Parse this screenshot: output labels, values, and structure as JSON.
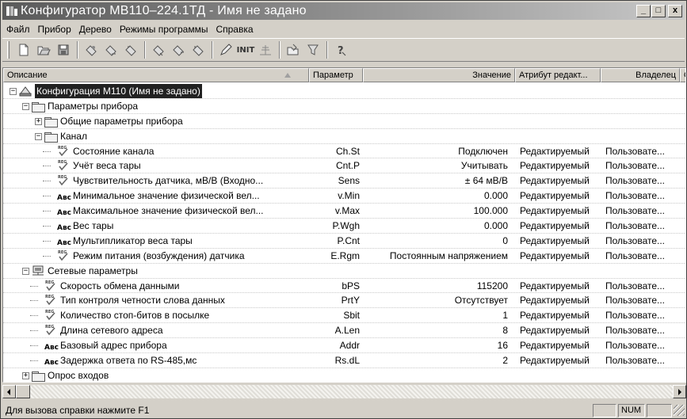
{
  "window": {
    "title": "Конфигуратор МВ110–224.1ТД - Имя не задано",
    "minimize": "_",
    "maximize": "□",
    "close": "x"
  },
  "menu": [
    {
      "label": "Файл"
    },
    {
      "label": "Прибор"
    },
    {
      "label": "Дерево"
    },
    {
      "label": "Режимы программы"
    },
    {
      "label": "Справка"
    }
  ],
  "toolbar": {
    "icons": [
      "new-file-icon",
      "open-file-icon",
      "save-file-icon",
      "device-read-icon",
      "device-write-icon",
      "device-connect-icon",
      "device-read-all-icon",
      "device-write-all-icon",
      "device-check-icon",
      "edit-icon",
      "init-icon",
      "network-icon",
      "folder-open-icon",
      "filter-icon",
      "help-icon"
    ],
    "init_label": "INIT"
  },
  "columns": {
    "desc": "Описание",
    "param": "Параметр",
    "value": "Значение",
    "attr": "Атрибут редакт...",
    "owner": "Владелец",
    "extra": "О"
  },
  "rows": [
    {
      "level": 0,
      "type": "root",
      "expand": "−",
      "desc": "Конфигурация М110 (Имя не задано)",
      "param": "",
      "value": "",
      "attr": "",
      "owner": ""
    },
    {
      "level": 1,
      "type": "folder",
      "expand": "−",
      "desc": "Параметры прибора",
      "param": "",
      "value": "",
      "attr": "",
      "owner": ""
    },
    {
      "level": 2,
      "type": "folder",
      "expand": "+",
      "desc": "Общие параметры прибора",
      "param": "",
      "value": "",
      "attr": "",
      "owner": ""
    },
    {
      "level": 2,
      "type": "folder",
      "expand": "−",
      "desc": "Канал",
      "param": "",
      "value": "",
      "attr": "",
      "owner": ""
    },
    {
      "level": 3,
      "type": "check",
      "desc": "Состояние канала",
      "param": "Ch.St",
      "value": "Подключен",
      "attr": "Редактируемый",
      "owner": "Пользовате..."
    },
    {
      "level": 3,
      "type": "check",
      "desc": "Учёт веса тары",
      "param": "Cnt.P",
      "value": "Учитывать",
      "attr": "Редактируемый",
      "owner": "Пользовате..."
    },
    {
      "level": 3,
      "type": "check",
      "desc": "Чувствительность датчика, мВ/В (Входно...",
      "param": "Sens",
      "value": "± 64 мВ/В",
      "attr": "Редактируемый",
      "owner": "Пользовате..."
    },
    {
      "level": 3,
      "type": "abc",
      "desc": "Минимальное значение физической вел...",
      "param": "v.Min",
      "value": "0.000",
      "attr": "Редактируемый",
      "owner": "Пользовате..."
    },
    {
      "level": 3,
      "type": "abc",
      "desc": "Максимальное значение физической вел...",
      "param": "v.Max",
      "value": "100.000",
      "attr": "Редактируемый",
      "owner": "Пользовате..."
    },
    {
      "level": 3,
      "type": "abc",
      "desc": "Вес тары",
      "param": "P.Wgh",
      "value": "0.000",
      "attr": "Редактируемый",
      "owner": "Пользовате..."
    },
    {
      "level": 3,
      "type": "abc",
      "desc": "Мультипликатор веса тары",
      "param": "P.Cnt",
      "value": "0",
      "attr": "Редактируемый",
      "owner": "Пользовате..."
    },
    {
      "level": 3,
      "type": "check",
      "desc": "Режим питания (возбуждения) датчика",
      "param": "E.Rgm",
      "value": "Постоянным напряжением",
      "attr": "Редактируемый",
      "owner": "Пользовате..."
    },
    {
      "level": 1,
      "type": "network",
      "expand": "−",
      "desc": "Сетевые параметры",
      "param": "",
      "value": "",
      "attr": "",
      "owner": ""
    },
    {
      "level": 2,
      "type": "check",
      "desc": "Скорость обмена данными",
      "param": "bPS",
      "value": "115200",
      "attr": "Редактируемый",
      "owner": "Пользовате..."
    },
    {
      "level": 2,
      "type": "check",
      "desc": "Тип контроля четности слова данных",
      "param": "PrtY",
      "value": "Отсутствует",
      "attr": "Редактируемый",
      "owner": "Пользовате..."
    },
    {
      "level": 2,
      "type": "check",
      "desc": "Количество стоп-битов в посылке",
      "param": "Sbit",
      "value": "1",
      "attr": "Редактируемый",
      "owner": "Пользовате..."
    },
    {
      "level": 2,
      "type": "check",
      "desc": "Длина сетевого адреса",
      "param": "A.Len",
      "value": "8",
      "attr": "Редактируемый",
      "owner": "Пользовате..."
    },
    {
      "level": 2,
      "type": "abc",
      "desc": "Базовый адрес прибора",
      "param": "Addr",
      "value": "16",
      "attr": "Редактируемый",
      "owner": "Пользовате..."
    },
    {
      "level": 2,
      "type": "abc",
      "desc": "Задержка ответа по RS-485,мс",
      "param": "Rs.dL",
      "value": "2",
      "attr": "Редактируемый",
      "owner": "Пользовате..."
    },
    {
      "level": 1,
      "type": "folder",
      "expand": "+",
      "desc": "Опрос входов",
      "param": "",
      "value": "",
      "attr": "",
      "owner": ""
    }
  ],
  "status": {
    "text": "Для вызова справки нажмите F1",
    "num": "NUM"
  },
  "row_icon_labels": {
    "abc": "Авс",
    "check": "REG"
  }
}
